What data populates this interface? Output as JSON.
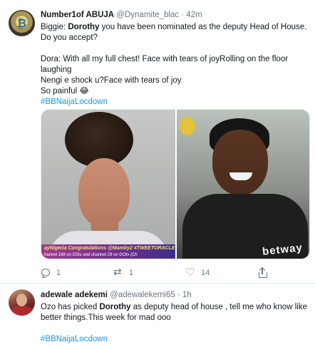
{
  "tweets": [
    {
      "name": "Number1of ABUJA",
      "handle": "@Dynamite_blac",
      "sep": "·",
      "time": "42m",
      "lines": {
        "l1_pre": "Biggie: ",
        "l1_bold": "Dorothy",
        "l1_post": " you have been nominated as the deputy Head of House. Do you accept?",
        "l2": "Dora: With all my full chest! Face with tears of joyRolling on the floor laughing",
        "l3": "Nengi e shock u?Face with tears of joy",
        "l4": "So painful 😂",
        "hashtag": "#BBNaijaLocdown"
      },
      "media": {
        "ticker_line1": "ayNigeria Congratulations @Mamby2 #TWEETORACLE Loc",
        "ticker_line2": "hannel 198 on DStv and channel 29 on GOtv (Ch",
        "logo": "betway"
      },
      "actions": {
        "replies": "1",
        "retweets": "1",
        "likes": "14"
      }
    },
    {
      "name": "adewale adekemi",
      "handle": "@adewalekemi65",
      "sep": "·",
      "time": "1h",
      "lines": {
        "l1_pre": "Ozo has picked ",
        "l1_bold": "Dorothy",
        "l1_post": " as deputy head of house , tell me who know like better things.This week for mad ooo",
        "hashtag": "#BBNaijaLocdown"
      }
    }
  ],
  "icons": {
    "reply": "reply-icon",
    "retweet": "retweet-icon",
    "like": "like-icon",
    "share": "share-icon"
  },
  "colors": {
    "hashtag": "#1b95e0",
    "muted": "#657786",
    "text": "#14171a"
  }
}
